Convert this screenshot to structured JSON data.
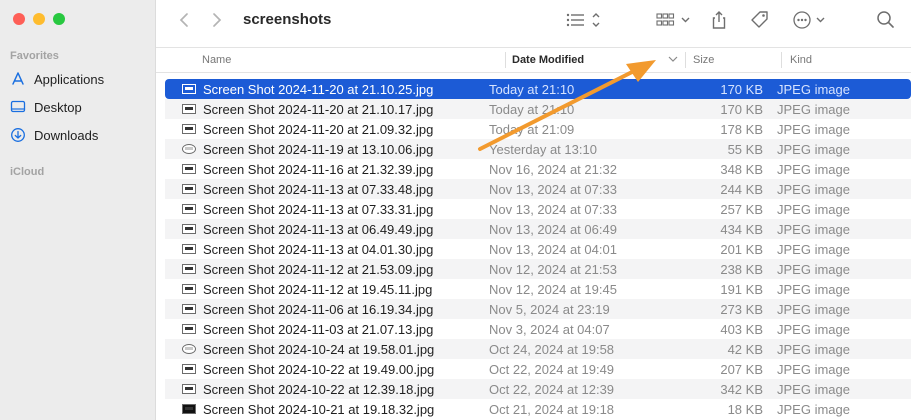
{
  "window": {
    "title": "screenshots"
  },
  "sidebar": {
    "favorites_title": "Favorites",
    "items": [
      {
        "label": "Applications",
        "icon": "applications-icon"
      },
      {
        "label": "Desktop",
        "icon": "desktop-icon"
      },
      {
        "label": "Downloads",
        "icon": "downloads-icon"
      }
    ],
    "icloud_title": "iCloud"
  },
  "toolbar": {
    "icons": [
      "back-icon",
      "forward-icon",
      "list-view-icon",
      "gallery-view-icon",
      "share-icon",
      "tag-icon",
      "more-icon",
      "search-icon"
    ]
  },
  "columns": {
    "name": "Name",
    "date": "Date Modified",
    "size": "Size",
    "kind": "Kind"
  },
  "files": [
    {
      "name": "Screen Shot 2024-11-20 at 21.10.25.jpg",
      "date": "Today at 21:10",
      "size": "170 KB",
      "kind": "JPEG image"
    },
    {
      "name": "Screen Shot 2024-11-20 at 21.10.17.jpg",
      "date": "Today at 21:10",
      "size": "170 KB",
      "kind": "JPEG image"
    },
    {
      "name": "Screen Shot 2024-11-20 at 21.09.32.jpg",
      "date": "Today at 21:09",
      "size": "178 KB",
      "kind": "JPEG image"
    },
    {
      "name": "Screen Shot 2024-11-19 at 13.10.06.jpg",
      "date": "Yesterday at 13:10",
      "size": "55 KB",
      "kind": "JPEG image"
    },
    {
      "name": "Screen Shot 2024-11-16 at 21.32.39.jpg",
      "date": "Nov 16, 2024 at 21:32",
      "size": "348 KB",
      "kind": "JPEG image"
    },
    {
      "name": "Screen Shot 2024-11-13 at 07.33.48.jpg",
      "date": "Nov 13, 2024 at 07:33",
      "size": "244 KB",
      "kind": "JPEG image"
    },
    {
      "name": "Screen Shot 2024-11-13 at 07.33.31.jpg",
      "date": "Nov 13, 2024 at 07:33",
      "size": "257 KB",
      "kind": "JPEG image"
    },
    {
      "name": "Screen Shot 2024-11-13 at 06.49.49.jpg",
      "date": "Nov 13, 2024 at 06:49",
      "size": "434 KB",
      "kind": "JPEG image"
    },
    {
      "name": "Screen Shot 2024-11-13 at 04.01.30.jpg",
      "date": "Nov 13, 2024 at 04:01",
      "size": "201 KB",
      "kind": "JPEG image"
    },
    {
      "name": "Screen Shot 2024-11-12 at 21.53.09.jpg",
      "date": "Nov 12, 2024 at 21:53",
      "size": "238 KB",
      "kind": "JPEG image"
    },
    {
      "name": "Screen Shot 2024-11-12 at 19.45.11.jpg",
      "date": "Nov 12, 2024 at 19:45",
      "size": "191 KB",
      "kind": "JPEG image"
    },
    {
      "name": "Screen Shot 2024-11-06 at 16.19.34.jpg",
      "date": "Nov 5, 2024 at 23:19",
      "size": "273 KB",
      "kind": "JPEG image"
    },
    {
      "name": "Screen Shot 2024-11-03 at 21.07.13.jpg",
      "date": "Nov 3, 2024 at 04:07",
      "size": "403 KB",
      "kind": "JPEG image"
    },
    {
      "name": "Screen Shot 2024-10-24 at 19.58.01.jpg",
      "date": "Oct 24, 2024 at 19:58",
      "size": "42 KB",
      "kind": "JPEG image"
    },
    {
      "name": "Screen Shot 2024-10-22 at 19.49.00.jpg",
      "date": "Oct 22, 2024 at 19:49",
      "size": "207 KB",
      "kind": "JPEG image"
    },
    {
      "name": "Screen Shot 2024-10-22 at 12.39.18.jpg",
      "date": "Oct 22, 2024 at 12:39",
      "size": "342 KB",
      "kind": "JPEG image"
    },
    {
      "name": "Screen Shot 2024-10-21 at 19.18.32.jpg",
      "date": "Oct 21, 2024 at 19:18",
      "size": "18 KB",
      "kind": "JPEG image"
    }
  ],
  "selected_row": 0,
  "colors": {
    "selection": "#1c5bd6",
    "annotation_arrow": "#f29a2e"
  }
}
